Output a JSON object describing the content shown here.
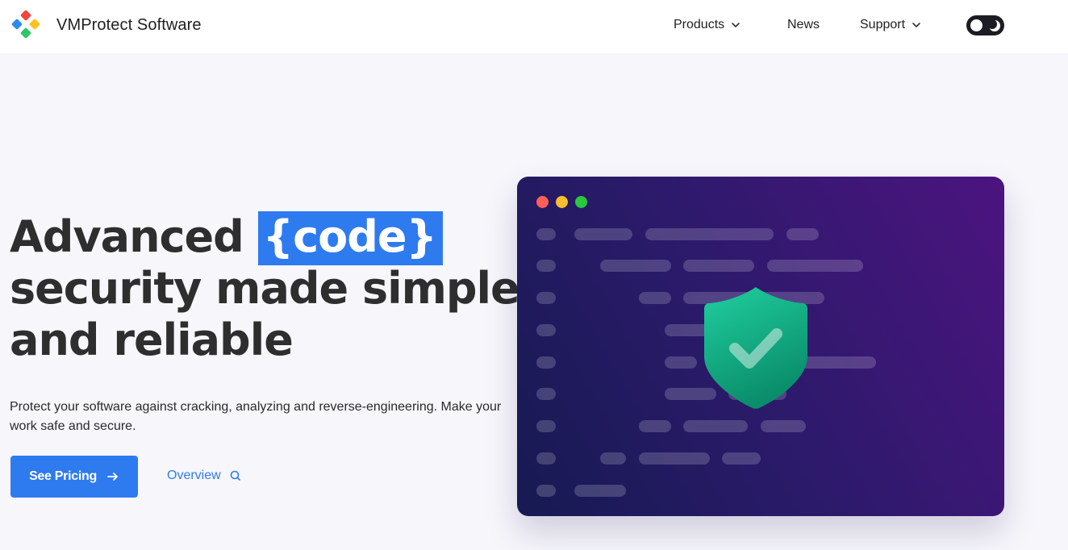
{
  "header": {
    "brand": "VMProtect Software",
    "nav": [
      {
        "label": "Products",
        "has_dropdown": true
      },
      {
        "label": "News",
        "has_dropdown": false
      },
      {
        "label": "Support",
        "has_dropdown": true
      }
    ],
    "theme_toggle": {
      "state": "dark",
      "icon": "moon-icon"
    }
  },
  "hero": {
    "headline_prefix": "Advanced",
    "headline_highlight": "{code}",
    "headline_line2": "security made simple",
    "headline_line3": "and reliable",
    "description": "Protect your software against cracking, analyzing and reverse-engineering. Make your work safe and secure.",
    "primary_button": "See Pricing",
    "secondary_link": "Overview"
  },
  "colors": {
    "accent": "#2e7bef",
    "shield_top": "#1ec99a",
    "shield_bottom": "#0a8f6c",
    "window_dots": [
      "#ff5f57",
      "#febc2e",
      "#28c840"
    ]
  }
}
